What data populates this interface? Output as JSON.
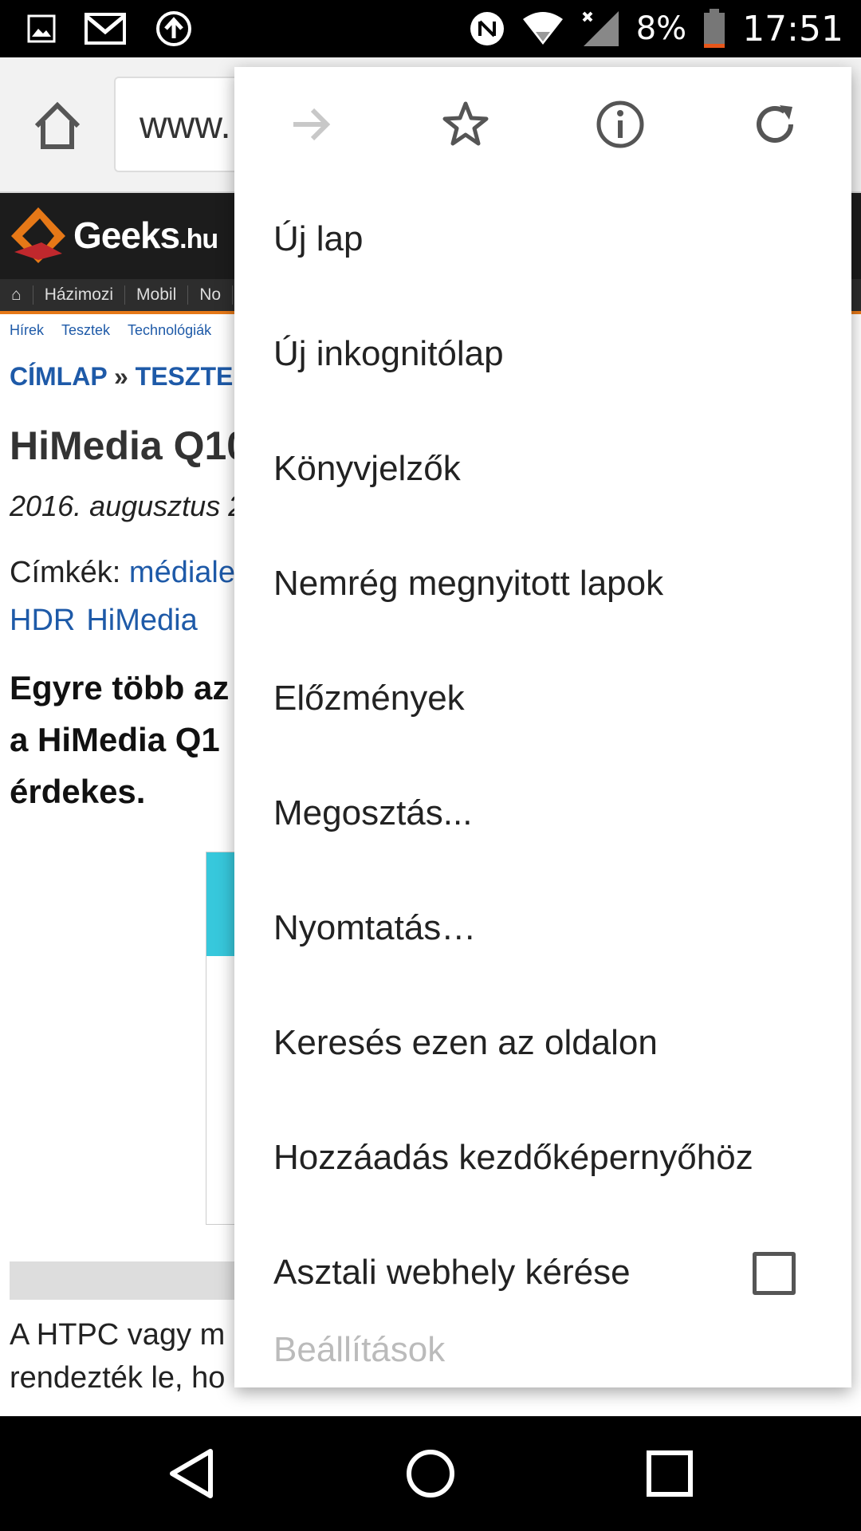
{
  "status_bar": {
    "icons_left": [
      "image-icon",
      "gmail-icon",
      "upload-icon"
    ],
    "icons_right": [
      "nfc-icon",
      "wifi-icon",
      "signal-icon",
      "battery-icon"
    ],
    "battery": "8%",
    "time": "17:51"
  },
  "toolbar": {
    "url_text": "www."
  },
  "page": {
    "logo_text": "Geeks",
    "logo_suffix": ".hu",
    "nav": [
      "Házimozi",
      "Mobil",
      "No"
    ],
    "subnav": [
      "Hírek",
      "Tesztek",
      "Technológiák"
    ],
    "crumb_home": "CÍMLAP",
    "crumb_sep": "»",
    "crumb_current": "TESZTE",
    "headline": "HiMedia Q10",
    "date": "2016. augusztus 2",
    "tags_label": "Címkék:",
    "tags_link": "médiale",
    "tags_more": [
      "HDR",
      "HiMedia"
    ],
    "lead": [
      "Egyre több az",
      "a HiMedia Q1",
      "érdekes."
    ],
    "body": [
      "A HTPC vagy m",
      "rendezték le, ho"
    ]
  },
  "menu": {
    "icons": [
      "forward-icon",
      "star-icon",
      "info-icon",
      "refresh-icon"
    ],
    "items": [
      {
        "label": "Új lap"
      },
      {
        "label": "Új inkognitólap"
      },
      {
        "label": "Könyvjelzők"
      },
      {
        "label": "Nemrég megnyitott lapok"
      },
      {
        "label": "Előzmények"
      },
      {
        "label": "Megosztás..."
      },
      {
        "label": "Nyomtatás…"
      },
      {
        "label": "Keresés ezen az oldalon"
      },
      {
        "label": "Hozzáadás kezdőképernyőhöz"
      },
      {
        "label": "Asztali webhely kérése",
        "checked": false
      }
    ],
    "cut_item": "Beállítások"
  },
  "nav_bar": {
    "buttons": [
      "back-icon",
      "home-circle-icon",
      "recents-icon"
    ]
  },
  "colors": {
    "link_blue": "#1e5aa8",
    "accent_orange": "#e67817",
    "ad_cyan": "#37c8dc"
  }
}
